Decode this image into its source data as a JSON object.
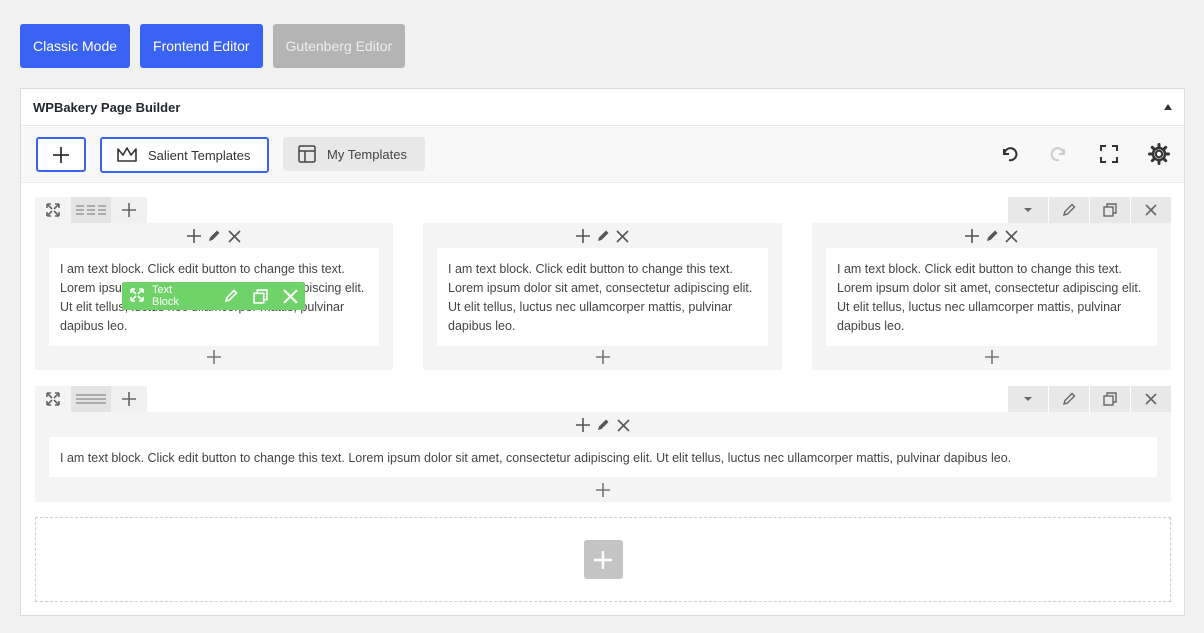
{
  "modes": {
    "classic": "Classic Mode",
    "frontend": "Frontend Editor",
    "gutenberg": "Gutenberg Editor"
  },
  "panel": {
    "title": "WPBakery Page Builder"
  },
  "toolbar": {
    "salient_templates": "Salient Templates",
    "my_templates": "My Templates"
  },
  "text_block": {
    "short": "I am text block. Click edit button to change this text. Lorem ipsum dolor sit amet, consectetur adipiscing elit. Ut elit tellus, luctus nec ullamcorper mattis, pulvinar dapibus leo.",
    "full": "I am text block. Click edit button to change this text. Lorem ipsum dolor sit amet, consectetur adipiscing elit. Ut elit tellus, luctus nec ullamcorper mattis, pulvinar dapibus leo."
  },
  "element_toolbar": {
    "label": "Text Block"
  },
  "colors": {
    "accent": "#3a63f4",
    "element_toolbar": "#6fd36a",
    "disabled": "#b4b4b4"
  }
}
